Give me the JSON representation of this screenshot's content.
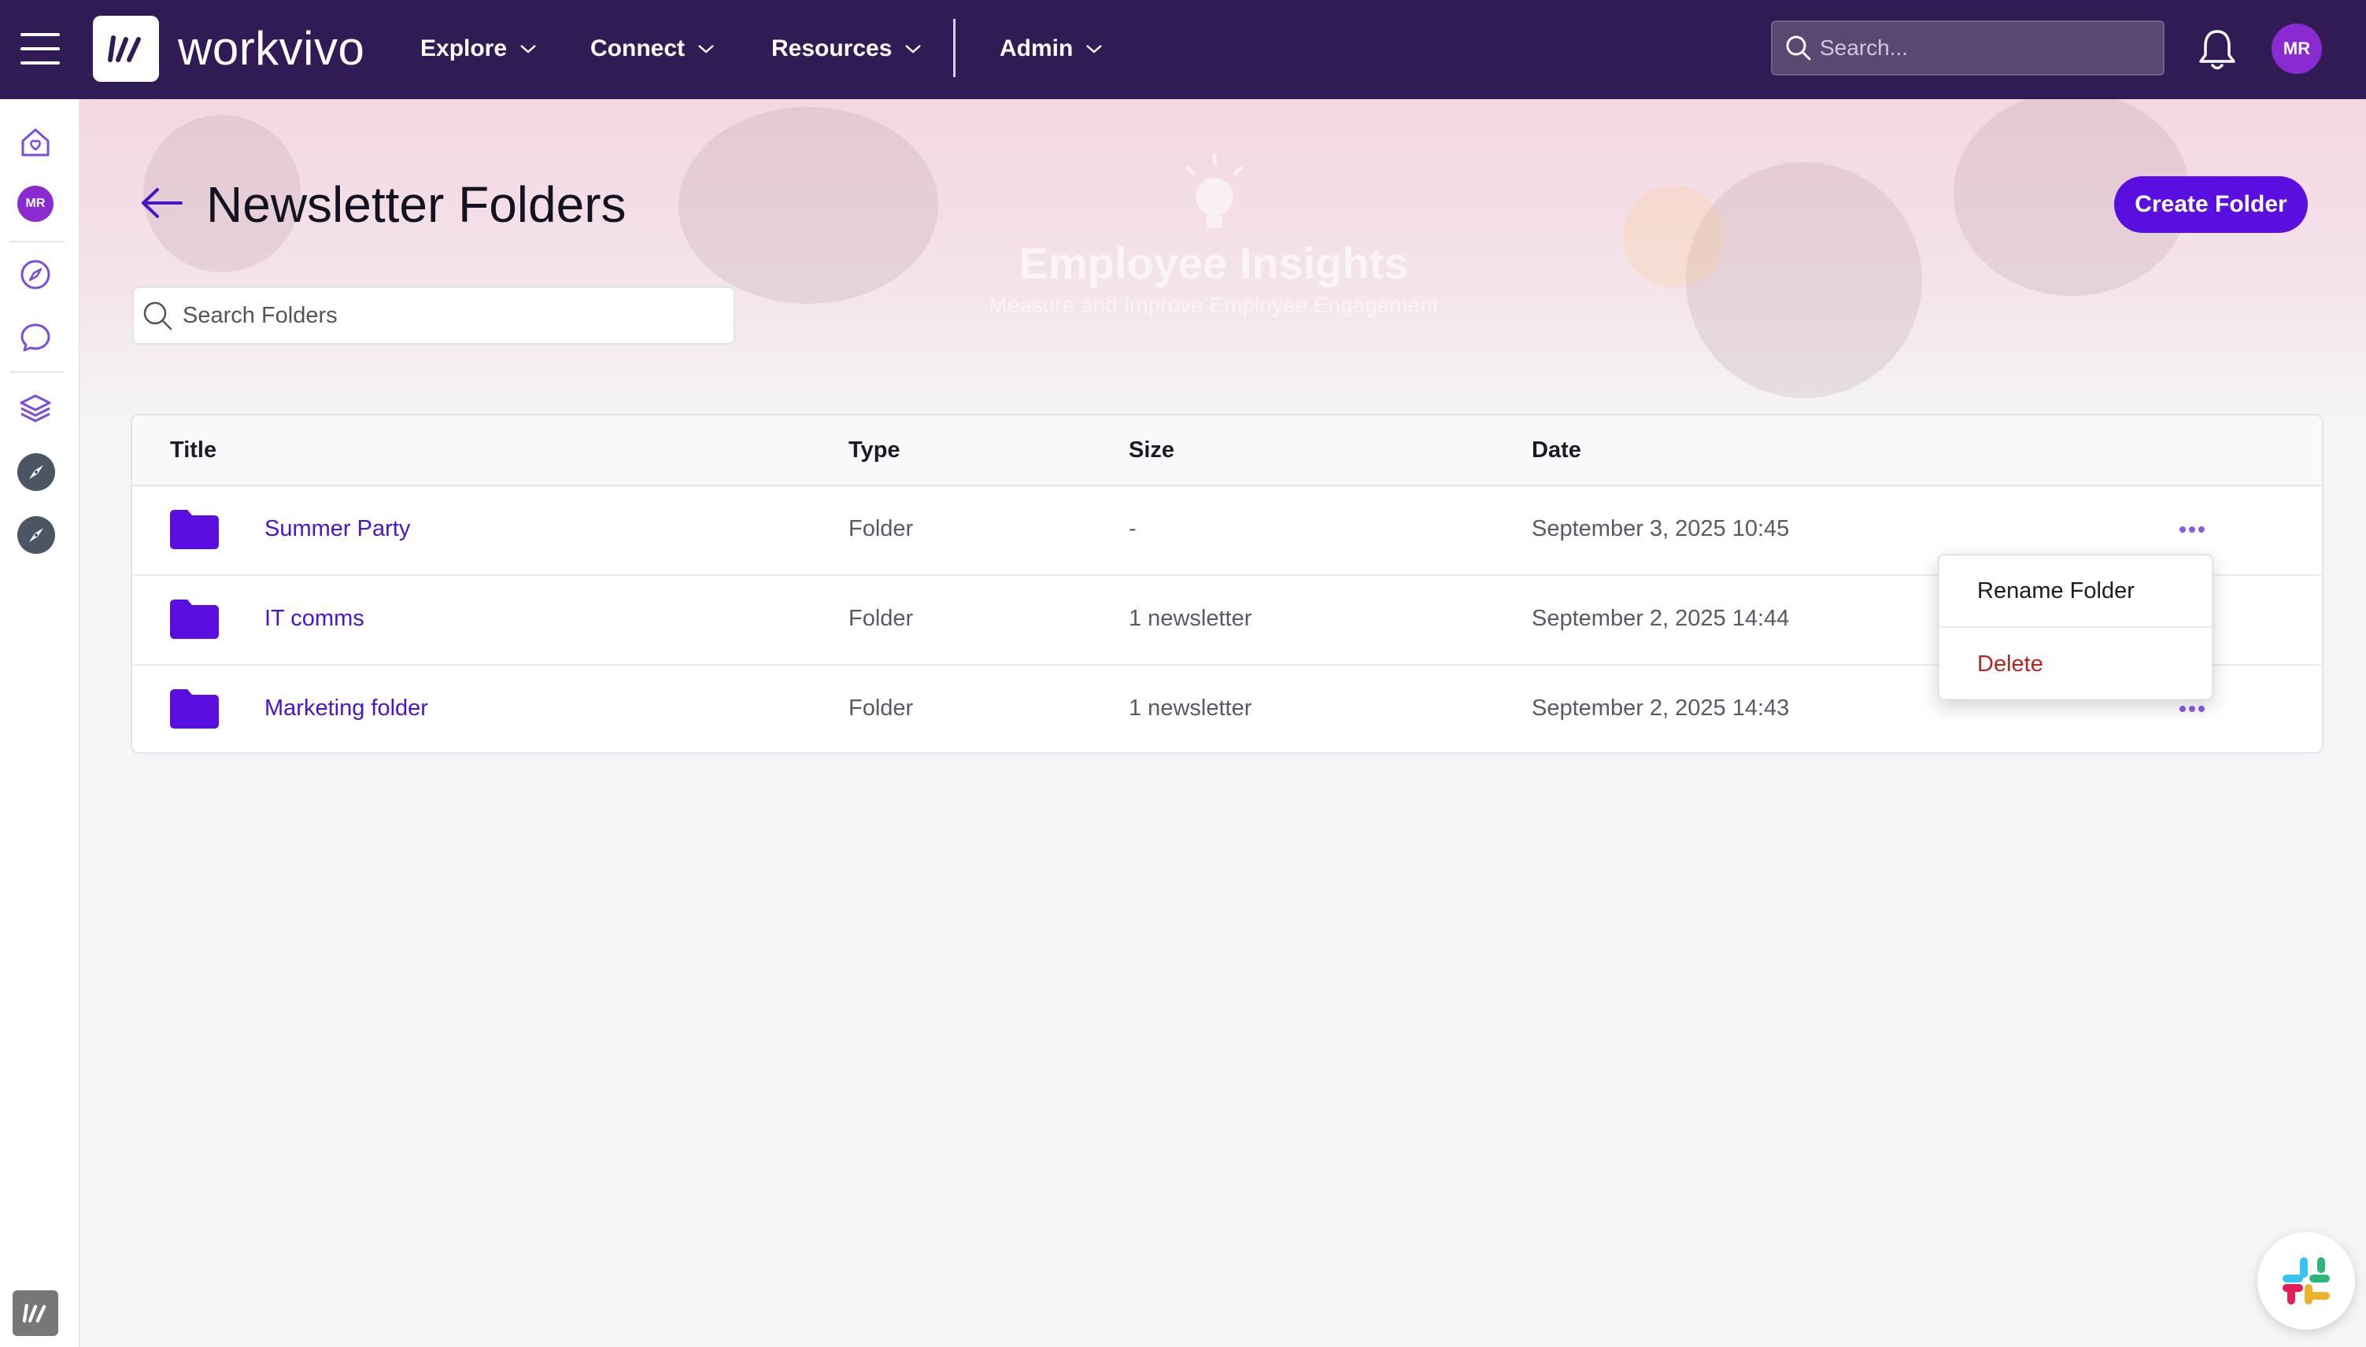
{
  "app": {
    "brand": "workvivo"
  },
  "topnav": {
    "items": [
      {
        "label": "Explore"
      },
      {
        "label": "Connect"
      },
      {
        "label": "Resources"
      },
      {
        "label": "Admin"
      }
    ],
    "search_placeholder": "Search...",
    "user_initials": "MR"
  },
  "sidebar": {
    "user_initials": "MR",
    "icons": [
      "home-heart-icon",
      "avatar",
      "compass-icon",
      "chat-bubble-icon",
      "layers-icon",
      "compass-app-icon",
      "compass-app-icon",
      "workvivo-logo-icon"
    ]
  },
  "banner": {
    "title": "Employee Insights",
    "subtitle": "Measure and Improve Employee Engagement"
  },
  "page": {
    "title": "Newsletter Folders",
    "create_button": "Create Folder",
    "search_placeholder": "Search Folders"
  },
  "table": {
    "columns": [
      "Title",
      "Type",
      "Size",
      "Date"
    ],
    "rows": [
      {
        "title": "Summer Party",
        "type": "Folder",
        "size": "-",
        "date": "September 3, 2025 10:45"
      },
      {
        "title": "IT comms",
        "type": "Folder",
        "size": "1 newsletter",
        "date": "September 2, 2025 14:44"
      },
      {
        "title": "Marketing folder",
        "type": "Folder",
        "size": "1 newsletter",
        "date": "September 2, 2025 14:43"
      }
    ]
  },
  "context_menu": {
    "rename": "Rename Folder",
    "delete": "Delete"
  },
  "colors": {
    "topbar": "#311b54",
    "accent": "#5a0fe0",
    "link": "#4a14c8",
    "danger": "#b3261e"
  }
}
